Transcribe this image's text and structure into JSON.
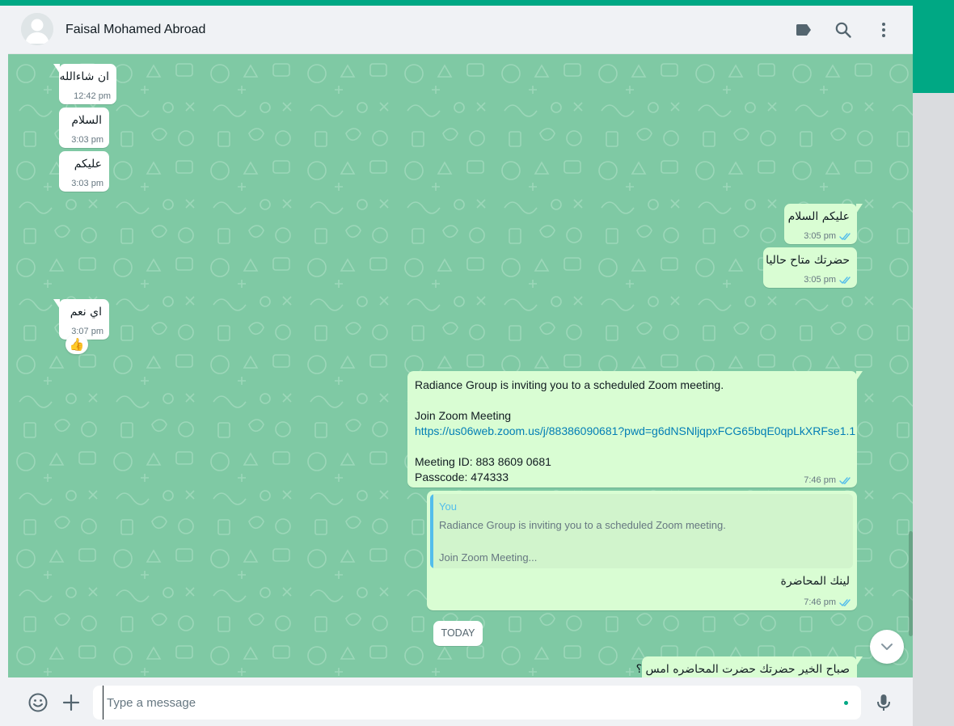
{
  "header": {
    "contact_name": "Faisal Mohamed Abroad",
    "icons": [
      "label-icon",
      "search-icon",
      "menu-dots-icon"
    ]
  },
  "messages": [
    {
      "direction": "in",
      "text": "ان شاءالله",
      "time": "12:42 pm"
    },
    {
      "direction": "in",
      "text": "السلام",
      "time": "3:03 pm"
    },
    {
      "direction": "in",
      "text": "عليكم",
      "time": "3:03 pm"
    },
    {
      "direction": "out",
      "text": "عليكم السلام",
      "time": "3:05 pm",
      "read": true
    },
    {
      "direction": "out",
      "text": "حضرتك متاح حاليا",
      "time": "3:05 pm",
      "read": true
    },
    {
      "direction": "in",
      "text": "اي نعم",
      "time": "3:07 pm",
      "reaction": "👍"
    },
    {
      "direction": "out",
      "lines": [
        "Radiance Group is inviting you to a scheduled Zoom meeting.",
        "",
        "Join Zoom Meeting",
        "https://us06web.zoom.us/j/88386090681?pwd=g6dNSNljqpxFCG65bqE0qpLkXRFse1.1",
        "",
        "Meeting ID: 883 8609 0681",
        "Passcode: 474333"
      ],
      "time": "7:46 pm",
      "read": true
    },
    {
      "direction": "out",
      "quote": {
        "author": "You",
        "line1": "Radiance Group is inviting you to a scheduled Zoom meeting.",
        "line2": "Join Zoom Meeting..."
      },
      "text": "لينك المحاضرة",
      "time": "7:46 pm",
      "read": true
    },
    {
      "direction": "out",
      "text": "صباح الخير حضرتك حضرت المحاضره امس ؟"
    }
  ],
  "date_divider": "TODAY",
  "composer": {
    "placeholder": "Type a message",
    "icons": [
      "emoji-icon",
      "attach-plus-icon",
      "microphone-icon"
    ]
  },
  "colors": {
    "accent": "#00a884",
    "chat_background": "#7fc9a4",
    "outgoing_bubble": "#d9fdd3",
    "incoming_bubble": "#ffffff",
    "read_ticks": "#53bdeb",
    "link": "#027eb5"
  }
}
